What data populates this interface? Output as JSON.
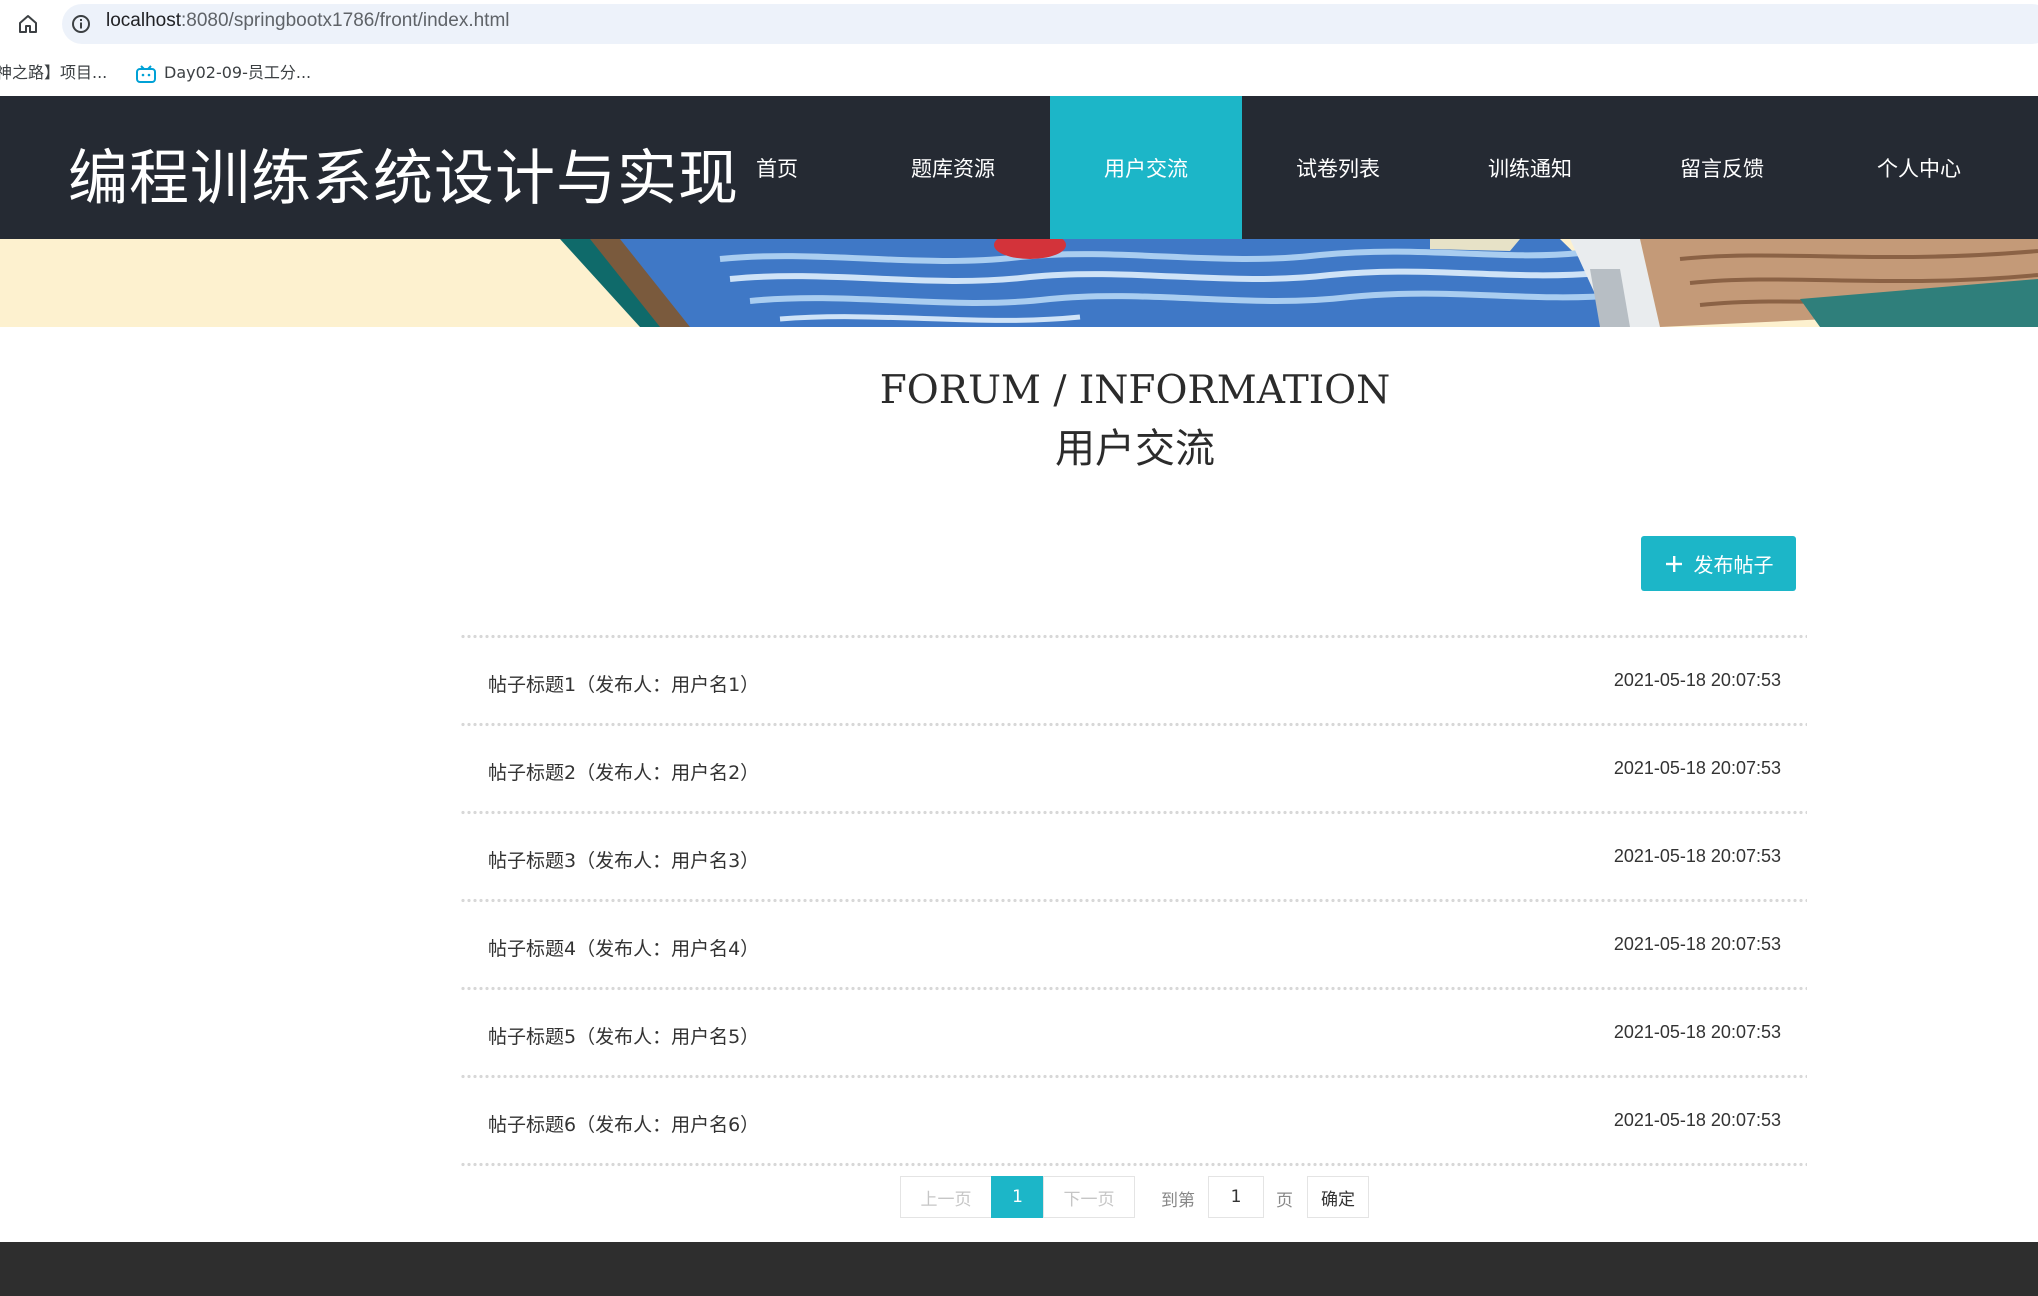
{
  "browser": {
    "url_host": "localhost",
    "url_path": ":8080/springbootx1786/front/index.html",
    "bookmarks": [
      {
        "label": "神之路】项目..."
      },
      {
        "label": "Day02-09-员工分..."
      }
    ]
  },
  "header": {
    "site_title": "编程训练系统设计与实现",
    "nav": [
      {
        "label": "首页"
      },
      {
        "label": "题库资源"
      },
      {
        "label": "用户交流"
      },
      {
        "label": "试卷列表"
      },
      {
        "label": "训练通知"
      },
      {
        "label": "留言反馈"
      },
      {
        "label": "个人中心"
      }
    ],
    "active_nav": "用户交流",
    "accent_color": "#1cb6c8",
    "header_bg": "#252a33"
  },
  "section": {
    "title_en": "FORUM / INFORMATION",
    "title_cn": "用户交流"
  },
  "actions": {
    "publish_label": "发布帖子"
  },
  "posts": [
    {
      "title": "帖子标题1（发布人：用户名1）",
      "time": "2021-05-18 20:07:53"
    },
    {
      "title": "帖子标题2（发布人：用户名2）",
      "time": "2021-05-18 20:07:53"
    },
    {
      "title": "帖子标题3（发布人：用户名3）",
      "time": "2021-05-18 20:07:53"
    },
    {
      "title": "帖子标题4（发布人：用户名4）",
      "time": "2021-05-18 20:07:53"
    },
    {
      "title": "帖子标题5（发布人：用户名5）",
      "time": "2021-05-18 20:07:53"
    },
    {
      "title": "帖子标题6（发布人：用户名6）",
      "time": "2021-05-18 20:07:53"
    }
  ],
  "pagination": {
    "prev_label": "上一页",
    "current_page": "1",
    "next_label": "下一页",
    "goto_prefix": "到第",
    "goto_value": "1",
    "goto_suffix": "页",
    "confirm_label": "确定"
  }
}
